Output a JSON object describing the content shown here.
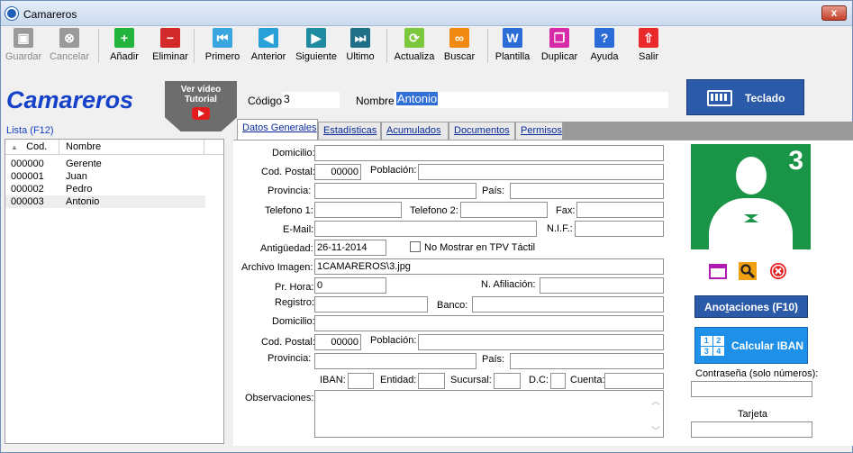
{
  "window": {
    "title": "Camareros",
    "close": "x"
  },
  "toolbar": {
    "items": [
      {
        "label": "Guardar",
        "icon": "save-icon",
        "color": "#9a9a9a",
        "glyph": "▣",
        "disabled": true
      },
      {
        "label": "Cancelar",
        "icon": "cancel-icon",
        "color": "#9a9a9a",
        "glyph": "⊗",
        "disabled": true
      },
      {
        "label": "Añadir",
        "icon": "plus-icon",
        "color": "#22b43c",
        "glyph": "+",
        "disabled": false
      },
      {
        "label": "Eliminar",
        "icon": "minus-icon",
        "color": "#d22a2a",
        "glyph": "−",
        "disabled": false
      },
      {
        "label": "Primero",
        "icon": "first-icon",
        "color": "#3aa6e0",
        "glyph": "⏮",
        "disabled": false
      },
      {
        "label": "Anterior",
        "icon": "previous-icon",
        "color": "#2aa0d8",
        "glyph": "◀",
        "disabled": false
      },
      {
        "label": "Siguiente",
        "icon": "next-icon",
        "color": "#1f8aa0",
        "glyph": "▶",
        "disabled": false
      },
      {
        "label": "Ultimo",
        "icon": "last-icon",
        "color": "#1f6f86",
        "glyph": "⏭",
        "disabled": false
      },
      {
        "label": "Actualiza",
        "icon": "refresh-icon",
        "color": "#7cc83c",
        "glyph": "⟳",
        "disabled": false
      },
      {
        "label": "Buscar",
        "icon": "binoculars-icon",
        "color": "#f08a10",
        "glyph": "∞",
        "disabled": false
      },
      {
        "label": "Plantilla",
        "icon": "word-icon",
        "color": "#2b6cd6",
        "glyph": "W",
        "disabled": false
      },
      {
        "label": "Duplicar",
        "icon": "duplicate-icon",
        "color": "#d62aa8",
        "glyph": "❐",
        "disabled": false
      },
      {
        "label": "Ayuda",
        "icon": "help-icon",
        "color": "#2b6cd6",
        "glyph": "?",
        "disabled": false
      },
      {
        "label": "Salir",
        "icon": "exit-icon",
        "color": "#e82a2a",
        "glyph": "⇧",
        "disabled": false
      }
    ]
  },
  "heading": "Camareros",
  "video": {
    "line1": "Ver vídeo",
    "line2": "Tutorial"
  },
  "codigo": {
    "label": "Código:",
    "value": "3"
  },
  "nombre": {
    "label": "Nombre:",
    "value": "Antonio"
  },
  "teclado": "Teclado",
  "lista": {
    "title": "Lista (F12)",
    "col_cod": "Cod.",
    "col_nombre": "Nombre",
    "rows": [
      {
        "cod": "000000",
        "nombre": "Gerente"
      },
      {
        "cod": "000001",
        "nombre": "Juan"
      },
      {
        "cod": "000002",
        "nombre": "Pedro"
      },
      {
        "cod": "000003",
        "nombre": "Antonio"
      }
    ]
  },
  "tabs": [
    "Datos Generales",
    "Estadísticas",
    "Acumulados",
    "Documentos",
    "Permisos"
  ],
  "form": {
    "domicilio": "Domicilio:",
    "cod_postal": "Cod. Postal:",
    "cod_postal_value": "00000",
    "poblacion": "Población:",
    "provincia": "Provincia:",
    "pais": "País:",
    "telefono1": "Telefono 1:",
    "telefono2": "Telefono 2:",
    "fax": "Fax:",
    "email": "E-Mail:",
    "nif": "N.I.F.:",
    "antiguedad": "Antigüedad:",
    "antiguedad_value": "26-11-2014",
    "no_mostrar": "No Mostrar en TPV Táctil",
    "archivo_imagen": "Archivo Imagen:",
    "archivo_imagen_value": "1CAMAREROS\\3.jpg",
    "pr_hora": "Pr. Hora:",
    "pr_hora_value": "0",
    "n_afiliacion": "N. Afiliación:",
    "registro": "Registro:",
    "banco": "Banco:",
    "domicilio2": "Domicilio:",
    "cod_postal2": "Cod. Postal:",
    "cod_postal2_value": "00000",
    "poblacion2": "Población:",
    "provincia2": "Provincia:",
    "pais2": "País:",
    "iban": "IBAN:",
    "entidad": "Entidad:",
    "sucursal": "Sucursal:",
    "dc": "D.C:",
    "cuenta": "Cuenta:",
    "observaciones": "Observaciones:"
  },
  "photo_number": "3",
  "anotaciones": {
    "pre": "Ano",
    "u": "t",
    "post": "aciones (F10)"
  },
  "calcular_iban": "Calcular IBAN",
  "iban_grid": [
    "1",
    "2",
    "3",
    "4"
  ],
  "contrasena": "Contraseña (solo números):",
  "tarjeta": "Tarjeta"
}
